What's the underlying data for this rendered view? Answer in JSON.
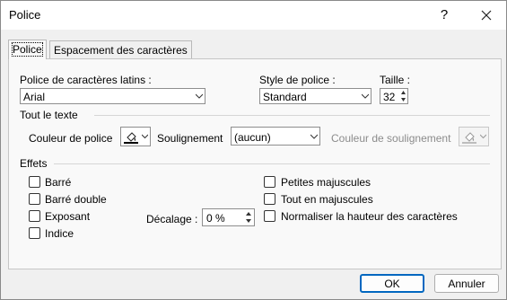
{
  "window": {
    "title": "Police",
    "help_label": "?"
  },
  "tabs": [
    {
      "label": "Police",
      "active": true
    },
    {
      "label": "Espacement des caractères",
      "active": false
    }
  ],
  "font": {
    "latin_label": "Police de caractères latins :",
    "latin_value": "Arial",
    "style_label": "Style de police :",
    "style_value": "Standard",
    "size_label": "Taille :",
    "size_value": "32"
  },
  "all_text": {
    "title": "Tout le texte",
    "color_label": "Couleur de police",
    "underline_label": "Soulignement",
    "underline_value": "(aucun)",
    "underline_color_label": "Couleur de soulignement"
  },
  "effects": {
    "title": "Effets",
    "left": [
      {
        "label": "Barré",
        "checked": false
      },
      {
        "label": "Barré double",
        "checked": false
      },
      {
        "label": "Exposant",
        "checked": false
      },
      {
        "label": "Indice",
        "checked": false
      }
    ],
    "right": [
      {
        "label": "Petites majuscules",
        "checked": false
      },
      {
        "label": "Tout en majuscules",
        "checked": false
      },
      {
        "label": "Normaliser la hauteur des caractères",
        "checked": false
      }
    ],
    "offset_label": "Décalage :",
    "offset_value": "0 %"
  },
  "buttons": {
    "ok": "OK",
    "cancel": "Annuler"
  },
  "colors": {
    "accent": "#0067c0",
    "font_color_swatch": "#000000"
  }
}
